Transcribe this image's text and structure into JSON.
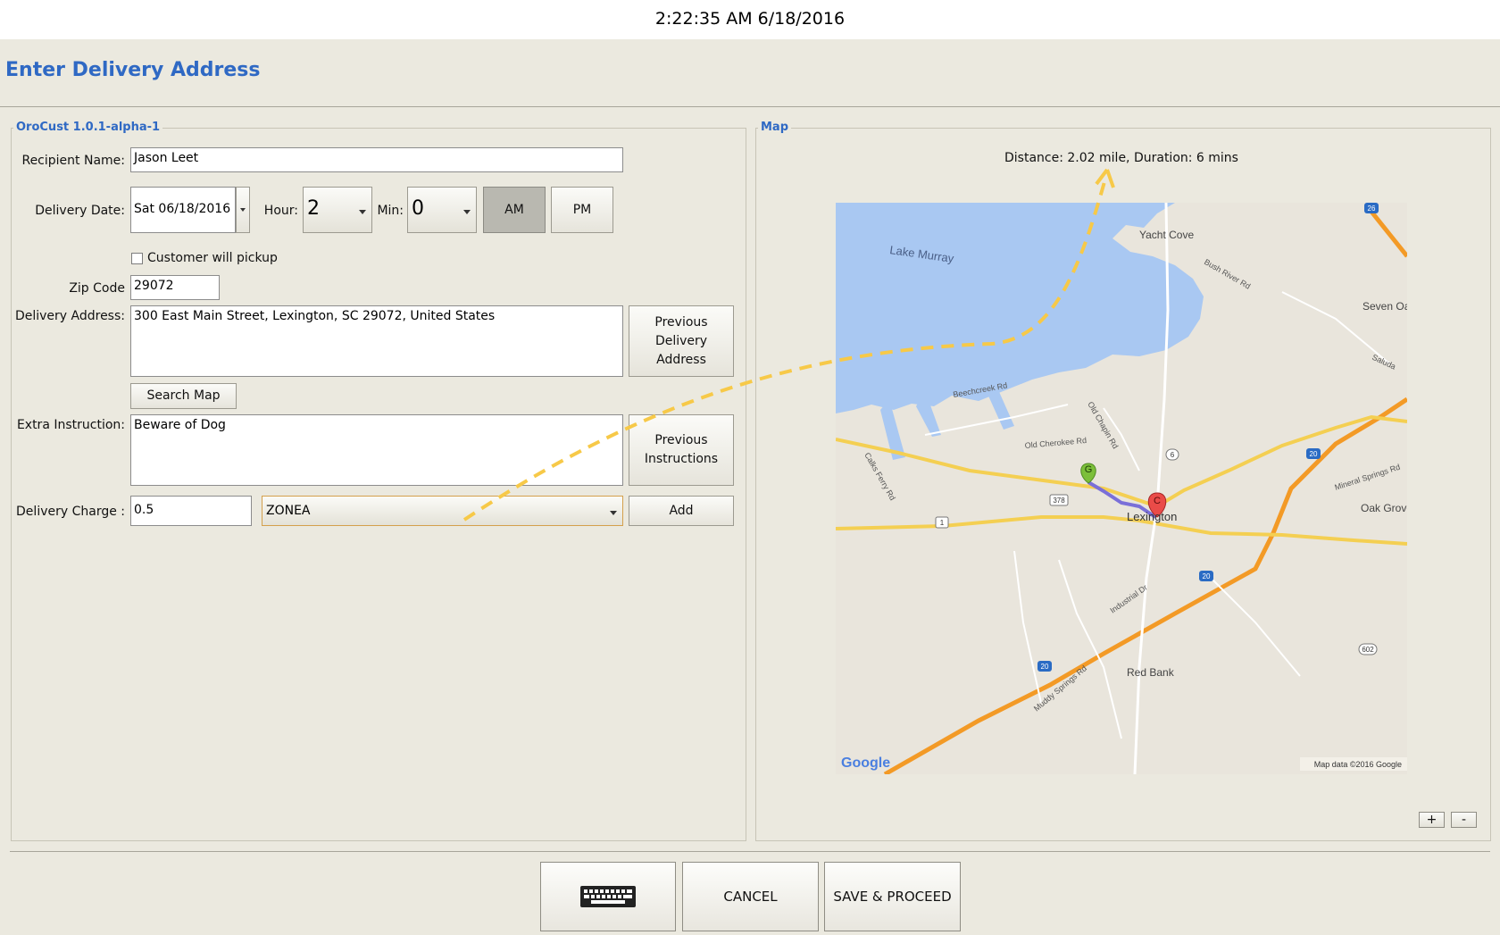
{
  "header": {
    "clock": "2:22:35 AM 6/18/2016",
    "title": "Enter Delivery Address"
  },
  "form": {
    "group_label": "OroCust 1.0.1-alpha-1",
    "recipient_label": "Recipient Name:",
    "recipient_value": "Jason  Leet",
    "date_label": "Delivery Date:",
    "date_value": "Sat 06/18/2016",
    "hour_label": "Hour:",
    "hour_value": "2",
    "min_label": "Min:",
    "min_value": "0",
    "am_label": "AM",
    "pm_label": "PM",
    "pickup_label": "Customer will pickup",
    "zip_label": "Zip Code",
    "zip_value": "29072",
    "address_label": "Delivery Address:",
    "address_value": "300 East Main Street, Lexington, SC 29072, United States",
    "prev_address_button": "Previous Delivery Address",
    "search_map_button": "Search Map",
    "instruction_label": "Extra Instruction:",
    "instruction_value": "Beware of Dog",
    "prev_instructions_button": "Previous Instructions",
    "charge_label": "Delivery Charge :",
    "charge_value": "0.5",
    "zone_value": "ZONEA",
    "add_button": "Add"
  },
  "map": {
    "group_label": "Map",
    "distance_text": "Distance: 2.02 mile, Duration: 6 mins",
    "places": {
      "yacht_cove": "Yacht Cove",
      "lake_murray": "Lake Murray",
      "seven_oaks": "Seven Oak",
      "lexington": "Lexington",
      "red_bank": "Red Bank",
      "oak_grove": "Oak Grove"
    },
    "roads": {
      "beechcreek": "Beechcreek Rd",
      "old_cherokee": "Old Cherokee Rd",
      "old_chapin": "Old Chapin Rd",
      "bush_river": "Bush River Rd",
      "calks_ferry": "Calks Ferry Rd",
      "industrial": "Industrial Dr",
      "muddy_springs": "Muddy Springs Rd",
      "mineral_springs": "Mineral Springs Rd",
      "saluda": "Saluda"
    },
    "shields": {
      "i20": "20",
      "r378": "378",
      "r1": "1",
      "r6": "6",
      "r602": "602",
      "r26": "26"
    },
    "markers": {
      "start": "G",
      "end": "C"
    },
    "google_logo": "Google",
    "attribution": "Map data ©2016 Google",
    "zoom_in": "+",
    "zoom_out": "-"
  },
  "footer": {
    "cancel": "CANCEL",
    "save": "SAVE & PROCEED"
  },
  "colors": {
    "accent": "#2f69c4",
    "water": "#a9c8f2",
    "highway": "#f39a26",
    "route": "#7a6fd8",
    "arrow": "#f7c948"
  }
}
